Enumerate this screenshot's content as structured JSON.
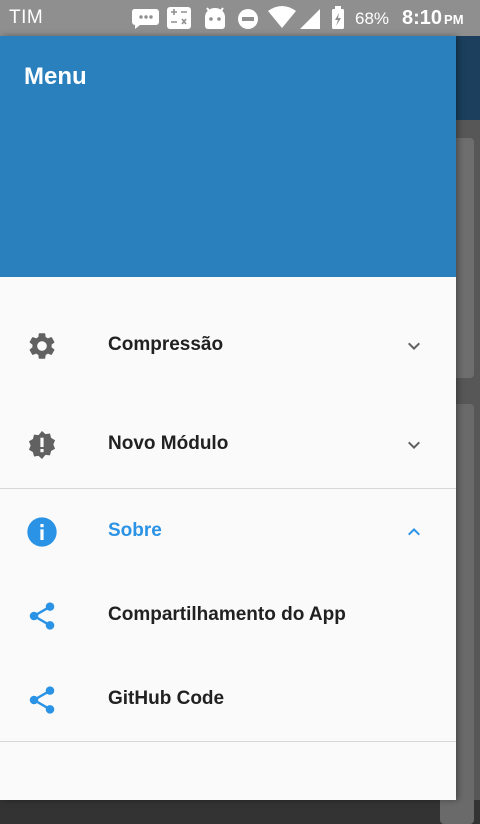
{
  "status_bar": {
    "carrier": "TIM",
    "battery_percent": "68%",
    "time": "8:10",
    "ampm": "PM"
  },
  "drawer": {
    "title": "Menu",
    "items": [
      {
        "label": "Compressão",
        "icon": "gear-icon",
        "chevron": "chevron-down-icon",
        "expanded": false
      },
      {
        "label": "Novo Módulo",
        "icon": "alert-badge-icon",
        "chevron": "chevron-down-icon",
        "expanded": false
      },
      {
        "label": "Sobre",
        "icon": "info-icon",
        "chevron": "chevron-up-icon",
        "expanded": true,
        "accent": "#2a93e6",
        "children": [
          {
            "label": "Compartilhamento do App",
            "icon": "share-icon"
          },
          {
            "label": "GitHub Code",
            "icon": "share-icon"
          }
        ]
      }
    ]
  },
  "colors": {
    "header": "#2a7fbd",
    "accent": "#2a93e6",
    "icon_gray": "#616161"
  }
}
